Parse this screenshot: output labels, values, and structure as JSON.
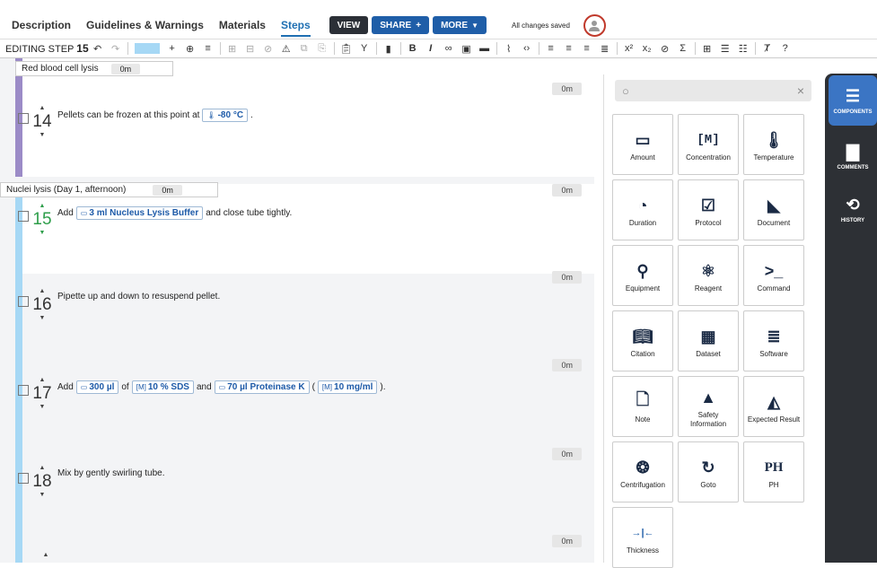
{
  "tabs": [
    "Description",
    "Guidelines & Warnings",
    "Materials",
    "Steps"
  ],
  "buttons": {
    "view": "VIEW",
    "share": "SHARE",
    "more": "MORE"
  },
  "saved_status": "All changes saved",
  "toolbar": {
    "editing_label": "EDITING STEP",
    "step_number": "15"
  },
  "sections": [
    {
      "name": "Red blood cell lysis",
      "duration": "0m",
      "color": "#9b8bc7"
    },
    {
      "name": "Nuclei lysis (Day 1, afternoon)",
      "duration": "0m",
      "color": "#a6d8f5"
    }
  ],
  "steps": [
    {
      "num": "14",
      "duration": "0m",
      "text": "Pellets can be frozen at this point at",
      "temp": "-80 °C",
      "tail": "."
    },
    {
      "num": "15",
      "duration": "0m",
      "pre": "Add",
      "amount": "3 ml Nucleus Lysis Buffer",
      "post": "and close tube tightly."
    },
    {
      "num": "16",
      "duration": "0m",
      "text": "Pipette up and down to resuspend pellet."
    },
    {
      "num": "17",
      "duration": "0m",
      "pre": "Add",
      "amount1": "300 µl",
      "mid1": "of",
      "conc1": "10 % SDS",
      "mid2": "and",
      "amount2": "70 µl Proteinase K",
      "paren_open": "(",
      "conc2": "10 mg/ml",
      "paren_close": ")."
    },
    {
      "num": "18",
      "duration": "0m",
      "text": "Mix by gently swirling tube."
    },
    {
      "num": "",
      "duration": "0m"
    }
  ],
  "components": [
    {
      "label": "Amount",
      "icon": "beaker-icon"
    },
    {
      "label": "Concentration",
      "icon": "concentration-icon",
      "glyph": "[M]"
    },
    {
      "label": "Temperature",
      "icon": "thermometer-icon"
    },
    {
      "label": "Duration",
      "icon": "timer-icon"
    },
    {
      "label": "Protocol",
      "icon": "protocol-icon"
    },
    {
      "label": "Document",
      "icon": "document-icon"
    },
    {
      "label": "Equipment",
      "icon": "microscope-icon"
    },
    {
      "label": "Reagent",
      "icon": "reagent-icon"
    },
    {
      "label": "Command",
      "icon": "terminal-icon"
    },
    {
      "label": "Citation",
      "icon": "book-icon"
    },
    {
      "label": "Dataset",
      "icon": "dataset-icon"
    },
    {
      "label": "Software",
      "icon": "database-icon"
    },
    {
      "label": "Note",
      "icon": "note-icon"
    },
    {
      "label": "Safety Information",
      "icon": "warning-icon"
    },
    {
      "label": "Expected Result",
      "icon": "chart-icon"
    },
    {
      "label": "Centrifugation",
      "icon": "centrifuge-icon"
    },
    {
      "label": "Goto",
      "icon": "goto-icon"
    },
    {
      "label": "PH",
      "icon": "ph-icon",
      "glyph": "PH"
    },
    {
      "label": "Thickness",
      "icon": "thickness-icon"
    }
  ],
  "rightbar": [
    "COMPONENTS",
    "COMMENTS",
    "HISTORY"
  ]
}
